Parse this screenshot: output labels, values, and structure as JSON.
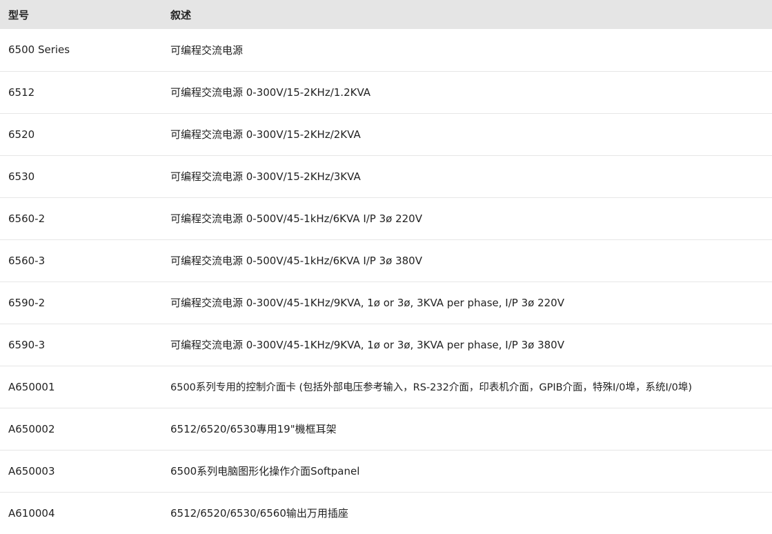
{
  "table": {
    "headers": [
      "型号",
      "叙述"
    ],
    "rows": [
      [
        "6500 Series",
        "可编程交流电源"
      ],
      [
        "6512",
        "可编程交流电源 0-300V/15-2KHz/1.2KVA"
      ],
      [
        "6520",
        "可编程交流电源 0-300V/15-2KHz/2KVA"
      ],
      [
        "6530",
        "可编程交流电源 0-300V/15-2KHz/3KVA"
      ],
      [
        "6560-2",
        "可编程交流电源 0-500V/45-1kHz/6KVA I/P 3ø 220V"
      ],
      [
        "6560-3",
        "可编程交流电源 0-500V/45-1kHz/6KVA I/P 3ø 380V"
      ],
      [
        "6590-2",
        "可编程交流电源 0-300V/45-1KHz/9KVA, 1ø or 3ø, 3KVA per phase, I/P 3ø 220V"
      ],
      [
        "6590-3",
        "可编程交流电源 0-300V/45-1KHz/9KVA, 1ø or 3ø, 3KVA per phase, I/P 3ø 380V"
      ],
      [
        "A650001",
        "6500系列专用的控制介面卡 (包括外部电压参考输入，RS-232介面，印表机介面，GPIB介面，特殊I/0埠，系统I/0埠)"
      ],
      [
        "A650002",
        "6512/6520/6530專用19\"機框耳架"
      ],
      [
        "A650003",
        "6500系列电脑图形化操作介面Softpanel"
      ],
      [
        "A610004",
        "6512/6520/6530/6560输出万用插座"
      ]
    ]
  }
}
